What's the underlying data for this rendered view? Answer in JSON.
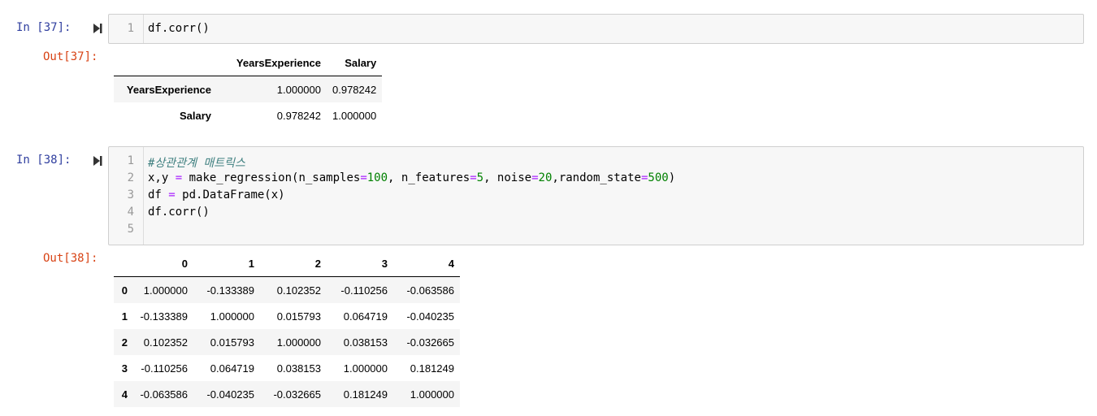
{
  "cells": [
    {
      "in_prompt": "In [37]:",
      "out_prompt": "Out[37]:",
      "code": [
        "df.corr()"
      ],
      "output": {
        "columns": [
          "YearsExperience",
          "Salary"
        ],
        "rows": [
          {
            "label": "YearsExperience",
            "values": [
              "1.000000",
              "0.978242"
            ]
          },
          {
            "label": "Salary",
            "values": [
              "0.978242",
              "1.000000"
            ]
          }
        ]
      }
    },
    {
      "in_prompt": "In [38]:",
      "out_prompt": "Out[38]:",
      "code": [
        "#상관관계 매트릭스",
        "x,y = make_regression(n_samples=100, n_features=5, noise=20,random_state=500)",
        "df = pd.DataFrame(x)",
        "df.corr()",
        ""
      ],
      "output": {
        "columns": [
          "0",
          "1",
          "2",
          "3",
          "4"
        ],
        "rows": [
          {
            "label": "0",
            "values": [
              "1.000000",
              "-0.133389",
              "0.102352",
              "-0.110256",
              "-0.063586"
            ]
          },
          {
            "label": "1",
            "values": [
              "-0.133389",
              "1.000000",
              "0.015793",
              "0.064719",
              "-0.040235"
            ]
          },
          {
            "label": "2",
            "values": [
              "0.102352",
              "0.015793",
              "1.000000",
              "0.038153",
              "-0.032665"
            ]
          },
          {
            "label": "3",
            "values": [
              "-0.110256",
              "0.064719",
              "0.038153",
              "1.000000",
              "0.181249"
            ]
          },
          {
            "label": "4",
            "values": [
              "-0.063586",
              "-0.040235",
              "-0.032665",
              "0.181249",
              "1.000000"
            ]
          }
        ]
      }
    }
  ],
  "icons": {
    "run": "run-cell-icon"
  }
}
